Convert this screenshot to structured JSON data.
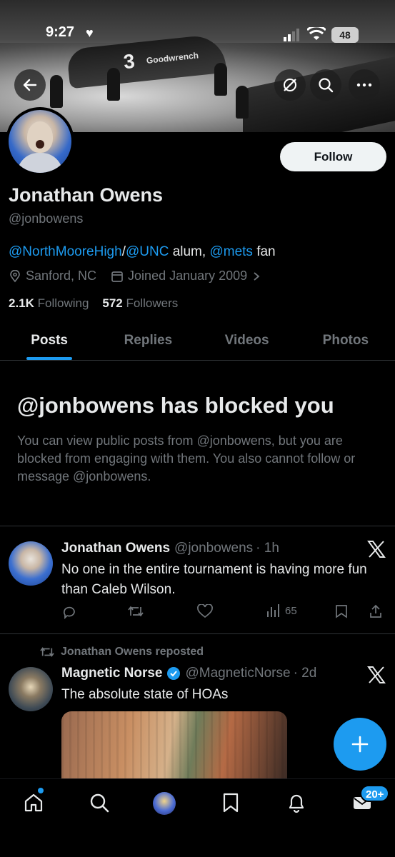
{
  "status_bar": {
    "time": "9:27",
    "heart": "♥",
    "battery": "48"
  },
  "profile": {
    "name": "Jonathan Owens",
    "handle": "@jonbowens",
    "bio_parts": [
      "@NorthMooreHigh",
      "/",
      "@UNC",
      " alum, ",
      "@mets",
      " fan"
    ],
    "location": "Sanford, NC",
    "joined": "Joined January 2009",
    "following_count": "2.1K",
    "following_label": "Following",
    "followers_count": "572",
    "followers_label": "Followers",
    "follow_button": "Follow"
  },
  "banner": {
    "car_number": "3",
    "car_brand": "Goodwrench"
  },
  "tabs": [
    {
      "label": "Posts",
      "active": true
    },
    {
      "label": "Replies",
      "active": false
    },
    {
      "label": "Videos",
      "active": false
    },
    {
      "label": "Photos",
      "active": false
    }
  ],
  "blocked": {
    "title": "@jonbowens has blocked you",
    "body": "You can view public posts from @jonbowens, but you are blocked from engaging with them. You also cannot follow or message @jonbowens."
  },
  "posts": [
    {
      "author": "Jonathan Owens",
      "handle": "@jonbowens",
      "time": "· 1h",
      "text": "No one in the entire tournament is having more fun than Caleb Wilson.",
      "views": "65"
    },
    {
      "repost_label": "Jonathan Owens reposted",
      "author": "Magnetic Norse",
      "handle": "@MagneticNorse",
      "time": "· 2d",
      "text": "The absolute state of HOAs"
    }
  ],
  "bottom_nav": {
    "mail_badge": "20+"
  },
  "colors": {
    "accent": "#1d9bf0",
    "background": "#000000",
    "muted": "#71767b",
    "text": "#e7e9ea"
  }
}
